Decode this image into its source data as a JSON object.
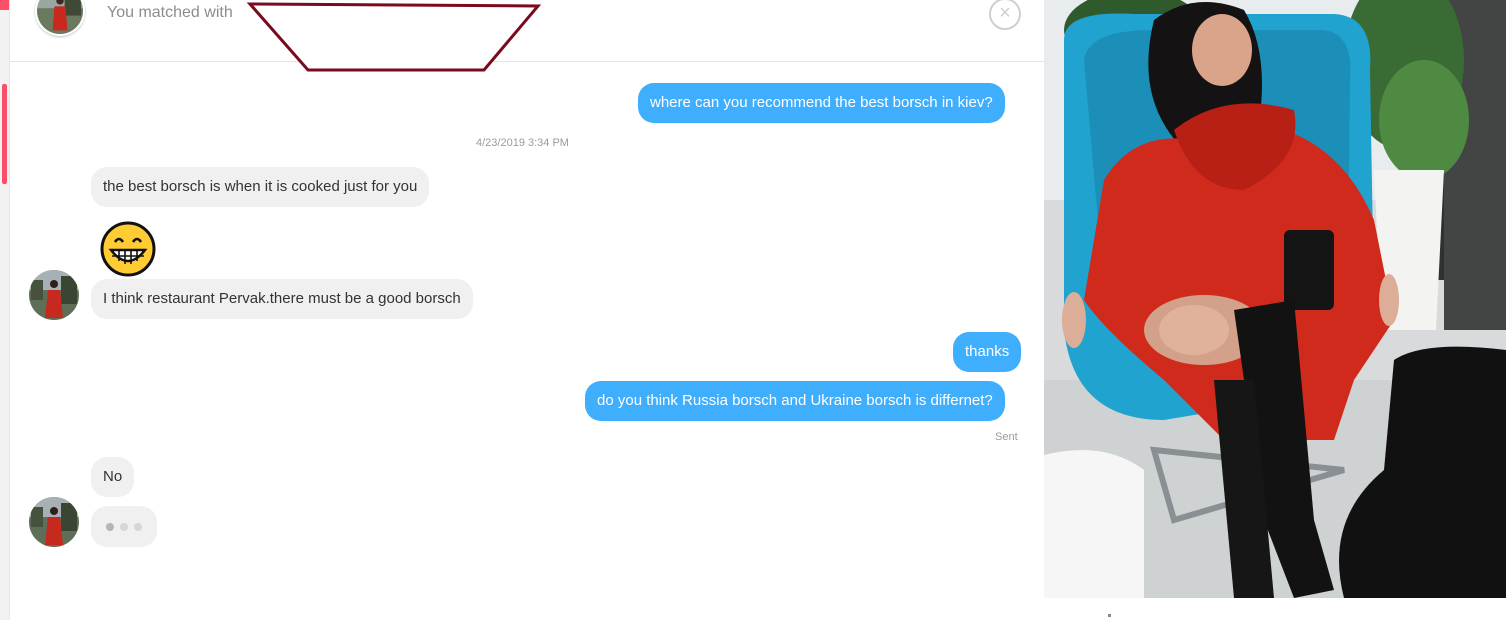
{
  "header": {
    "title_prefix": "You matched with",
    "close_icon": "×"
  },
  "messages": [
    {
      "from": "me",
      "text": "where can you recommend the best borsch in kiev?"
    },
    {
      "timestamp": "4/23/2019 3:34 PM"
    },
    {
      "from": "them",
      "text": "the best borsch is when it is cooked just for you"
    },
    {
      "from": "them",
      "emoji": "grinning-face"
    },
    {
      "from": "them",
      "text": "I think restaurant Pervak.there must be a good borsch"
    },
    {
      "from": "me",
      "text": "thanks"
    },
    {
      "from": "me",
      "text": "do you think Russia borsch and Ukraine borsch is differnet?"
    },
    {
      "status": "Sent"
    },
    {
      "from": "them",
      "text": "No"
    },
    {
      "from": "them",
      "typing": true
    }
  ],
  "colors": {
    "outgoing_bubble": "#3faefc",
    "incoming_bubble": "#f0f0f0",
    "brand_accent": "#fd5068",
    "redaction_outline": "#7a0a1e"
  }
}
